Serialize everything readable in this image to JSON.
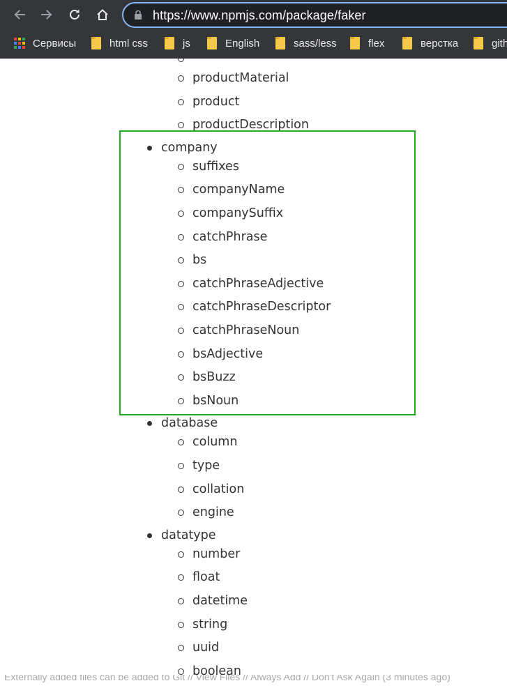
{
  "browser": {
    "url": "https://www.npmjs.com/package/faker",
    "colors": {
      "chrome": "#35363a",
      "omnibox": "#202124",
      "focus_ring": "#8ab4f8",
      "folder": "#f7c949"
    }
  },
  "bookmarks": [
    {
      "label": "Сервисы",
      "icon": "apps-icon"
    },
    {
      "label": "html css",
      "icon": "folder-icon"
    },
    {
      "label": "js",
      "icon": "folder-icon"
    },
    {
      "label": "English",
      "icon": "folder-icon"
    },
    {
      "label": "sass/less",
      "icon": "folder-icon"
    },
    {
      "label": "flex",
      "icon": "folder-icon"
    },
    {
      "label": "верстка",
      "icon": "folder-icon"
    },
    {
      "label": "github",
      "icon": "folder-icon"
    }
  ],
  "api_list": {
    "commerce_tail": [
      "productMaterial",
      "product",
      "productDescription"
    ],
    "sections": [
      {
        "name": "company",
        "items": [
          "suffixes",
          "companyName",
          "companySuffix",
          "catchPhrase",
          "bs",
          "catchPhraseAdjective",
          "catchPhraseDescriptor",
          "catchPhraseNoun",
          "bsAdjective",
          "bsBuzz",
          "bsNoun"
        ]
      },
      {
        "name": "database",
        "items": [
          "column",
          "type",
          "collation",
          "engine"
        ]
      },
      {
        "name": "datatype",
        "items": [
          "number",
          "float",
          "datetime",
          "string",
          "uuid",
          "boolean"
        ]
      }
    ]
  },
  "highlight": {
    "color": "#22b022",
    "section": "company"
  },
  "status_bar": {
    "text": "Externally added files can be added to Git // View Files // Always Add // Don't Ask Again (3 minutes ago)"
  }
}
